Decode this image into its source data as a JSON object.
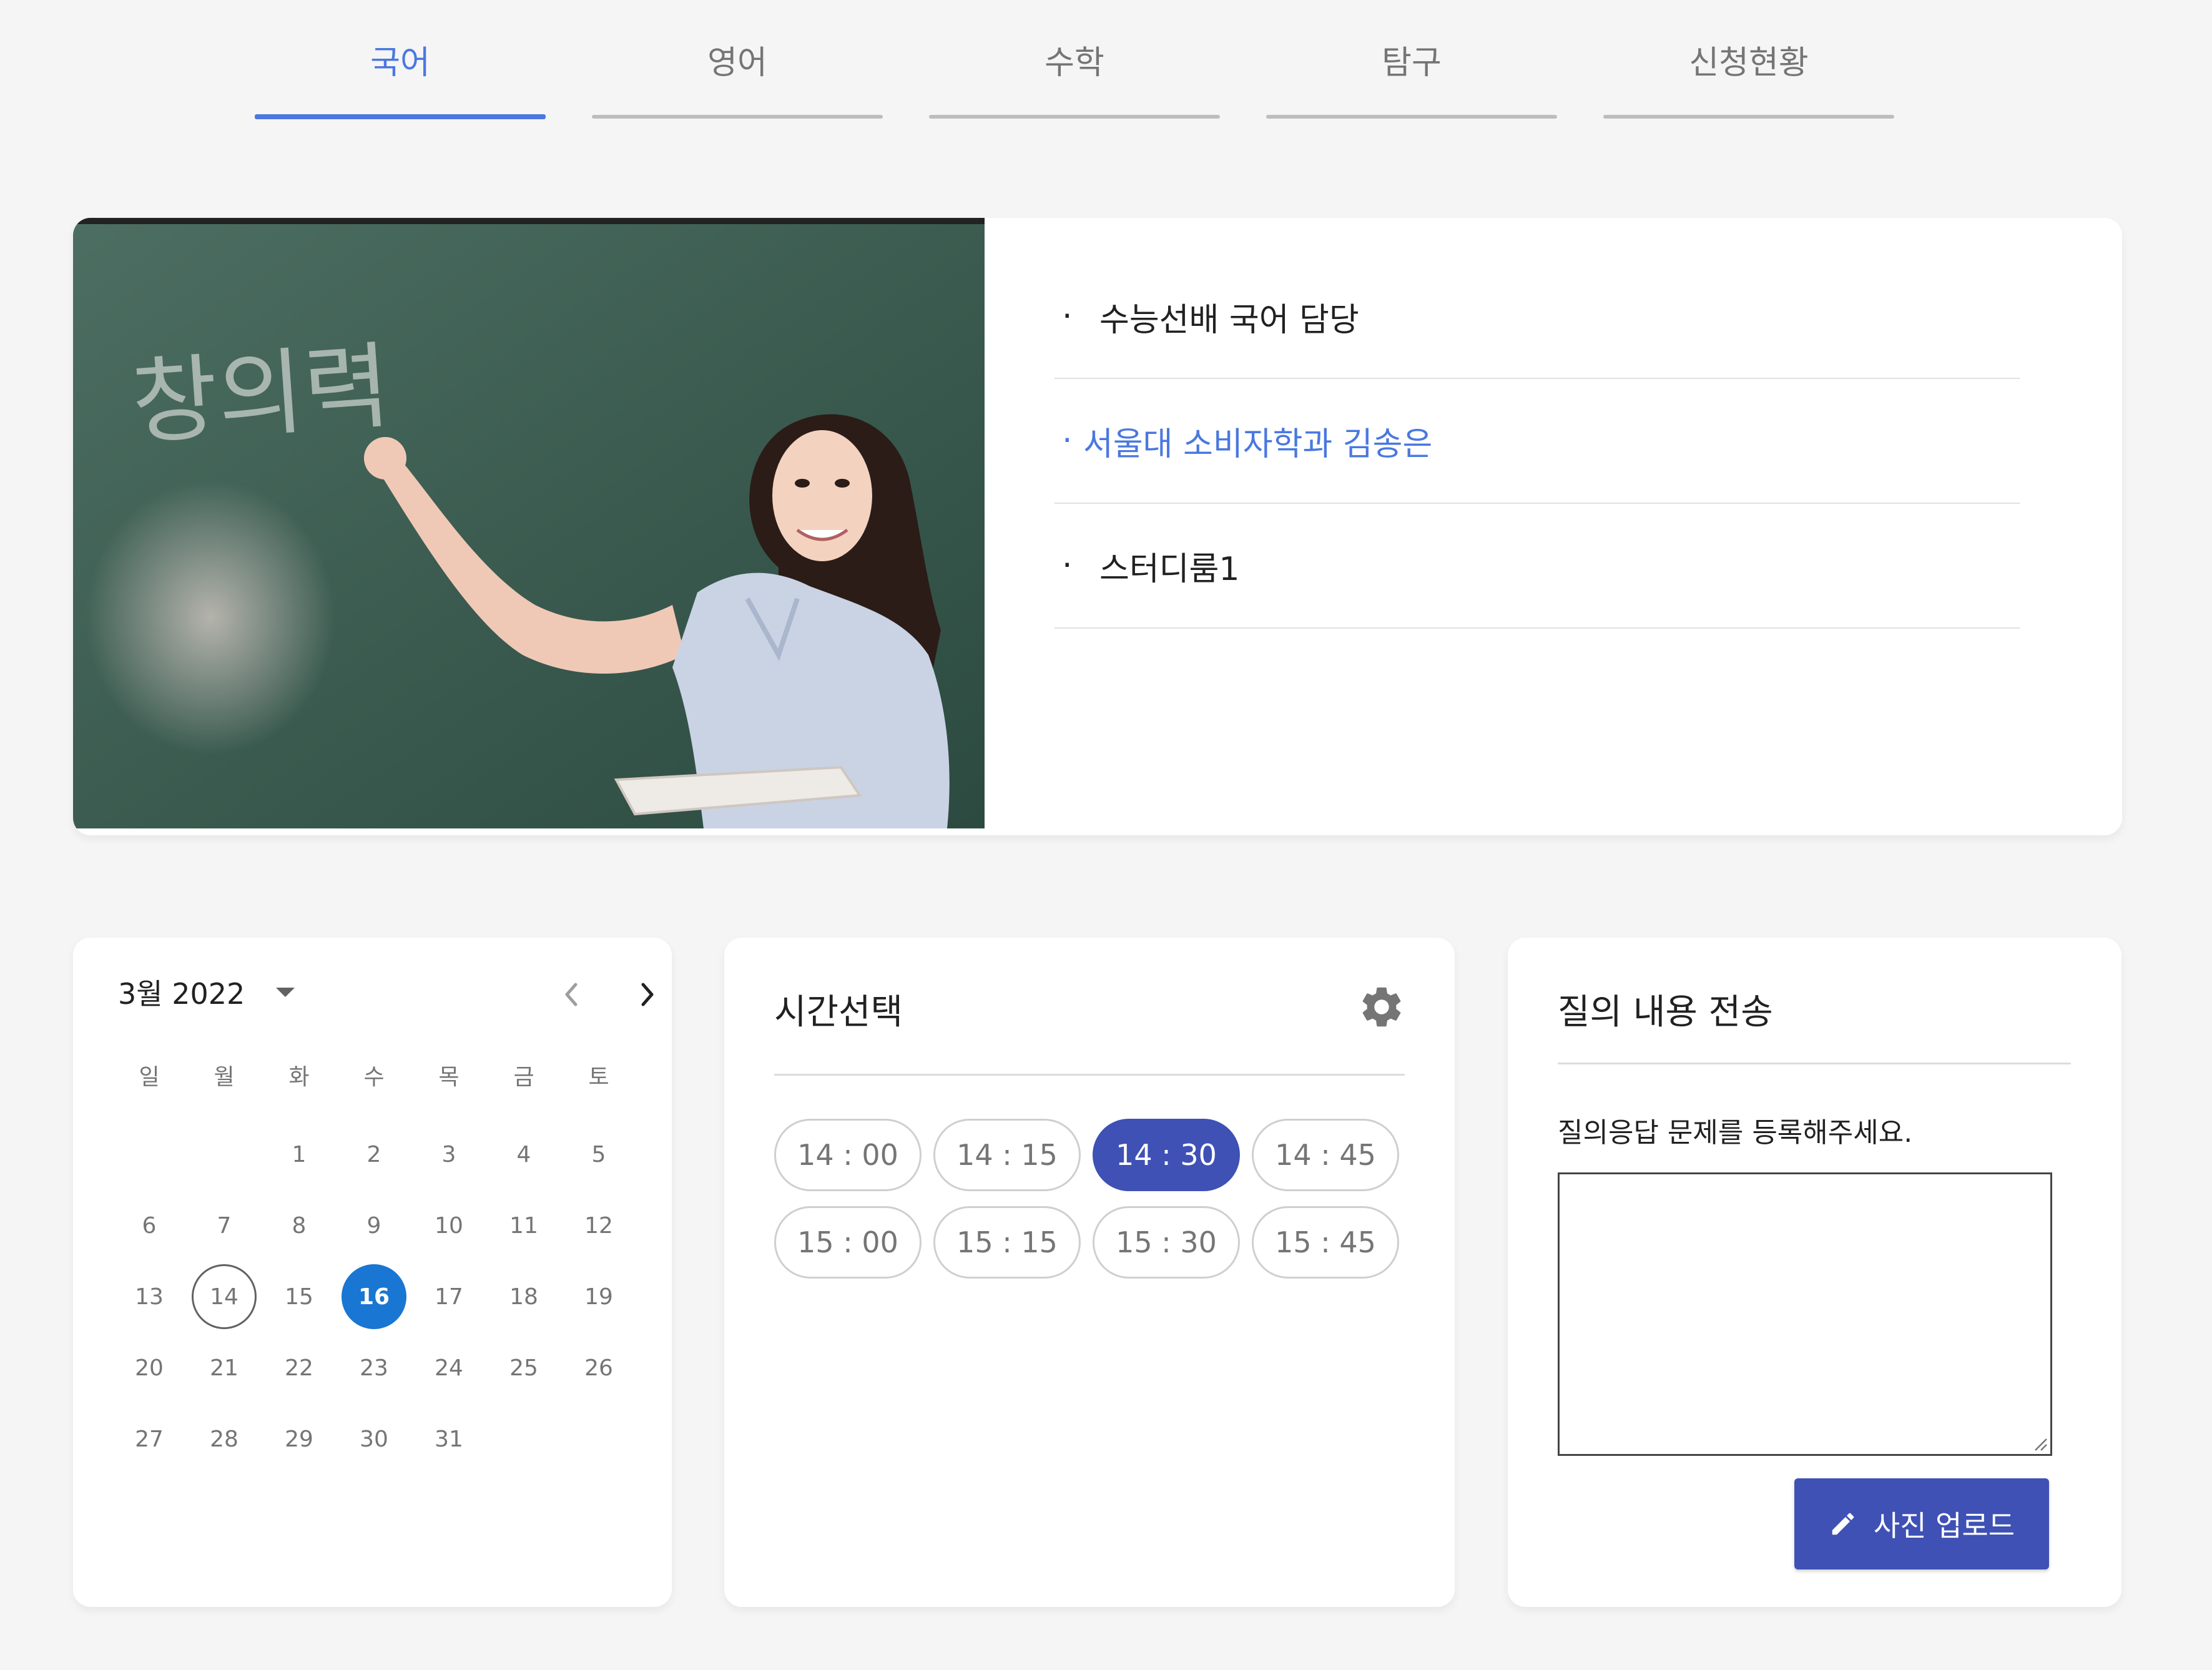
{
  "tabs": [
    {
      "label": "국어",
      "active": true
    },
    {
      "label": "영어",
      "active": false
    },
    {
      "label": "수학",
      "active": false
    },
    {
      "label": "탐구",
      "active": false
    },
    {
      "label": "신청현황",
      "active": false
    }
  ],
  "hero": {
    "chalkboard_text": "창의력",
    "info": [
      {
        "bullet": "·",
        "text": "수능선배 국어 담당"
      },
      {
        "bullet": "·",
        "text": "서울대 소비자학과 김송은"
      },
      {
        "bullet": "·",
        "text": "스터디룸1"
      }
    ]
  },
  "calendar": {
    "month_label": "3월 2022",
    "weekdays": [
      "일",
      "월",
      "화",
      "수",
      "목",
      "금",
      "토"
    ],
    "weeks": [
      [
        "",
        "",
        "1",
        "2",
        "3",
        "4",
        "5"
      ],
      [
        "6",
        "7",
        "8",
        "9",
        "10",
        "11",
        "12"
      ],
      [
        "13",
        "14",
        "15",
        "16",
        "17",
        "18",
        "19"
      ],
      [
        "20",
        "21",
        "22",
        "23",
        "24",
        "25",
        "26"
      ],
      [
        "27",
        "28",
        "29",
        "30",
        "31",
        "",
        ""
      ]
    ],
    "today": "14",
    "selected": "16",
    "selected_color": "#1976d2"
  },
  "time_select": {
    "title": "시간선택",
    "icon": "gear-icon",
    "slots": [
      "14 : 00",
      "14 : 15",
      "14 : 30",
      "14 : 45",
      "15 : 00",
      "15 : 15",
      "15 : 30",
      "15 : 45"
    ],
    "selected": "14 : 30",
    "selected_color": "#3f51b5"
  },
  "question": {
    "title": "질의 내용 전송",
    "prompt": "질의응답 문제를 등록해주세요.",
    "textarea_value": "",
    "upload_label": "사진 업로드",
    "upload_icon": "pencil-icon",
    "button_color": "#3f51b5"
  }
}
